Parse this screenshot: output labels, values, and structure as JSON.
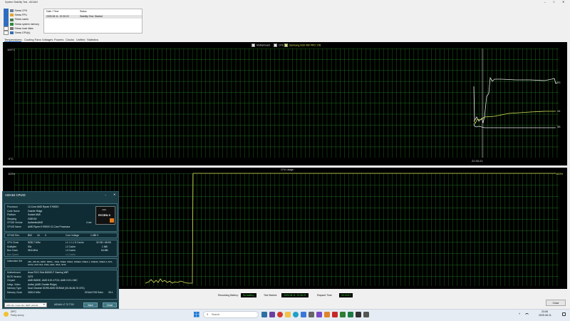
{
  "window": {
    "title": "System Stability Test - AIDA64"
  },
  "stress": [
    {
      "label": "Stress CPU",
      "checked": true,
      "icon": "cpu-icon"
    },
    {
      "label": "Stress FPU",
      "checked": true,
      "icon": "fpu-icon"
    },
    {
      "label": "Stress cache",
      "checked": true,
      "icon": "cache-icon"
    },
    {
      "label": "Stress system memory",
      "checked": true,
      "icon": "memory-icon"
    },
    {
      "label": "Stress local disks",
      "checked": false,
      "icon": "disk-icon"
    },
    {
      "label": "Stress GPU(s)",
      "checked": false,
      "icon": "gpu-icon"
    }
  ],
  "log": {
    "headers": [
      "Date / Time",
      "Status"
    ],
    "rows": [
      [
        "2025.08.11. 22:30:22",
        "Stability Test: Started"
      ]
    ]
  },
  "tabs": [
    "Temperatures",
    "Cooling Fans",
    "Voltages",
    "Powers",
    "Clocks",
    "Unified",
    "Statistics"
  ],
  "temp_chart": {
    "legend": [
      "Motherboard",
      "CPU",
      "Samsung SSD 980 PRO 1TB"
    ],
    "legend_colors": [
      "#e8e8e8",
      "#e8e8e8",
      "#d8e25a"
    ],
    "ymax": "100°C",
    "ymin": "0°C",
    "time_label": "22:30:21",
    "values": {
      "cpu": "93",
      "ssd": "44",
      "mb": "38"
    }
  },
  "cpu_chart": {
    "title": "CPU Usage",
    "ymax": "100%",
    "ymin": "0%",
    "right_max": "100%"
  },
  "cpuid": {
    "title": "AIDA64 CPUID",
    "processor": {
      "label": "Processor",
      "value": "12-Core AMD Ryzen 9 9900X"
    },
    "codename": {
      "label": "Code Name",
      "value": "Granite Ridge"
    },
    "platform": {
      "label": "Platform",
      "value": "Socket AM5"
    },
    "stepping": {
      "label": "Stepping",
      "value": "GNR-B0"
    },
    "vendor": {
      "label": "CPUID Vendor",
      "value": "AuthenticAMD",
      "nm": "4 nm"
    },
    "cpuname": {
      "label": "CPUID Name",
      "value": "AMD Ryzen 9 9900X 12-Core Processor"
    },
    "rev": {
      "label": "CPUID Rev.",
      "v1": "B00",
      "v2": "44",
      "v3": "0"
    },
    "corev": {
      "label": "Core Voltage",
      "value": "1.280 V"
    },
    "cpu_clock": {
      "label": "CPU Clock",
      "value": "5230.7 MHz"
    },
    "multiplier": {
      "label": "Multiplier",
      "value": "53x"
    },
    "bus_clock": {
      "label": "Bus Clock",
      "value": "98.8 MHz"
    },
    "bus_speed": {
      "label": "Bus Speed"
    },
    "l1": {
      "label": "L1 I / L1 D Cache",
      "value": "32 KB / 48 KB"
    },
    "l2": {
      "label": "L2 Cache",
      "value": "1 MB"
    },
    "l3": {
      "label": "L3 Cache",
      "value": "64 MB"
    },
    "l4": {
      "label": "L4 Cache"
    },
    "iset": {
      "label": "Instruction Set",
      "value": "x86, x86-64, MMX, MMX+, SSE, SSE2, SSE3, SSSE3, SSE4.1, SSE4A, SSE4.2, AVX, AVX2, AVX-512, FMA, AES, SHA, SHA"
    },
    "mb": {
      "label": "Motherboard",
      "value": "Asus ROG Strix B650E-F Gaming WiFi"
    },
    "bios": {
      "label": "BIOS Version",
      "value": "3279"
    },
    "chipset": {
      "label": "Chipset",
      "value": "AMD B650E, AMD K19.4 FCH, AMD K19.4 IMC"
    },
    "video": {
      "label": "Integr. Video",
      "value": "Active (AMD Granite Ridge)"
    },
    "memtype": {
      "label": "Memory Type",
      "value": "Dual Channel DDR5-6000 SDRAM (30-36-36-76 CR1)"
    },
    "memclock": {
      "label": "Memory Clock",
      "value": "3000.0 MHz",
      "ratio_label": "DRAM:FSB Ratio",
      "ratio": "30:1"
    },
    "core_select": "CPU #1 / Core #1 / SMT Unit #1",
    "version": "AIDA64 v7.70.7700",
    "save": "Save",
    "close": "Close",
    "logo": "RYZEN 9"
  },
  "status": {
    "battery_label": "Remaining Battery:",
    "battery_value": "No battery",
    "started_label": "Test Started:",
    "started_value": "2025.08.11. 22:30:21",
    "elapsed_label": "Elapsed Time:",
    "elapsed_value": "00:15:01",
    "close": "Close"
  },
  "taskbar": {
    "weather_temp": "29°C",
    "weather_desc": "Partly sunny",
    "search": "Search",
    "time": "23:06",
    "date": "2025.08.11."
  }
}
